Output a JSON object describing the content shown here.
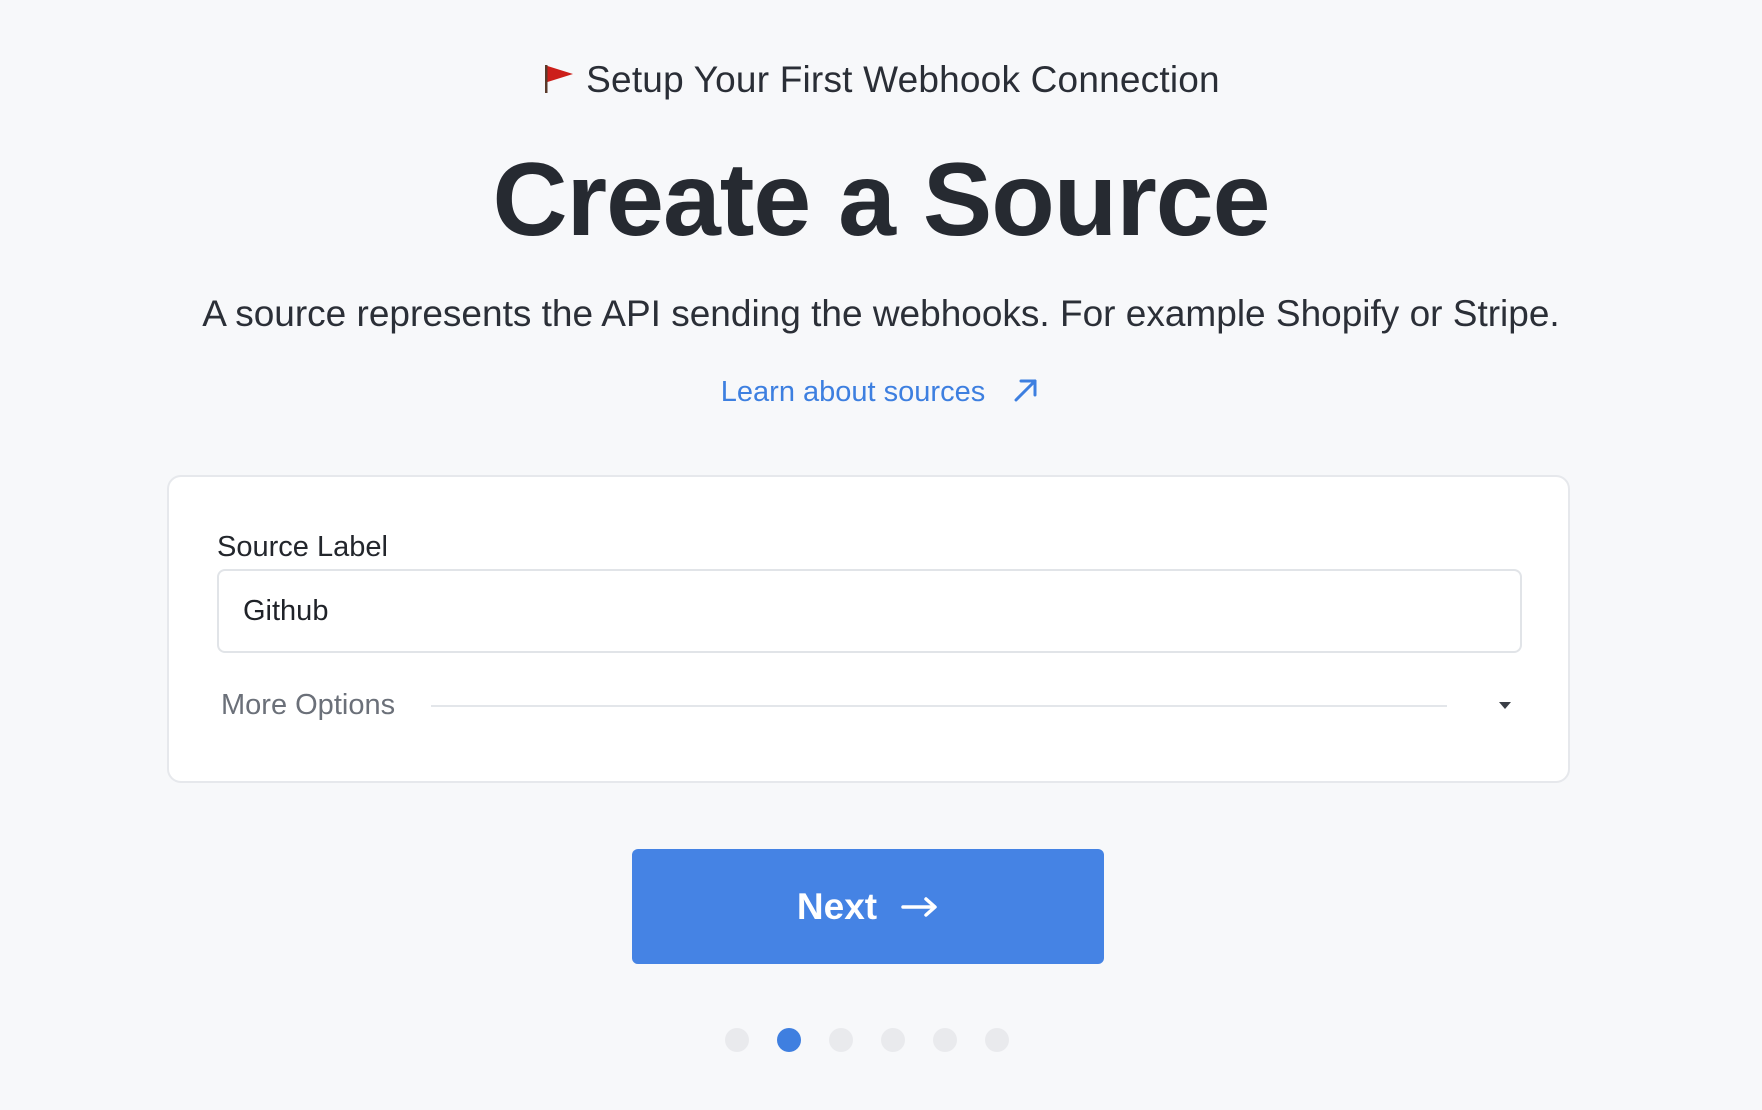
{
  "header": {
    "kicker": "Setup Your First Webhook Connection",
    "kicker_icon": "red-flag-icon",
    "title": "Create a Source",
    "subtitle": "A source represents the API sending the webhooks. For example Shopify or Stripe.",
    "learn_link": "Learn about sources",
    "learn_link_icon": "external-arrow-icon"
  },
  "form": {
    "source_label": "Source Label",
    "source_value": "Github",
    "more_options_label": "More Options",
    "more_options_icon": "caret-down-icon"
  },
  "actions": {
    "next_label": "Next",
    "next_icon": "arrow-right-icon"
  },
  "progress": {
    "total_steps": 6,
    "current_step": 2
  },
  "colors": {
    "background": "#f7f8fa",
    "accent": "#4583e4",
    "link": "#3d7fe0",
    "flag": "#cc1f1a"
  }
}
